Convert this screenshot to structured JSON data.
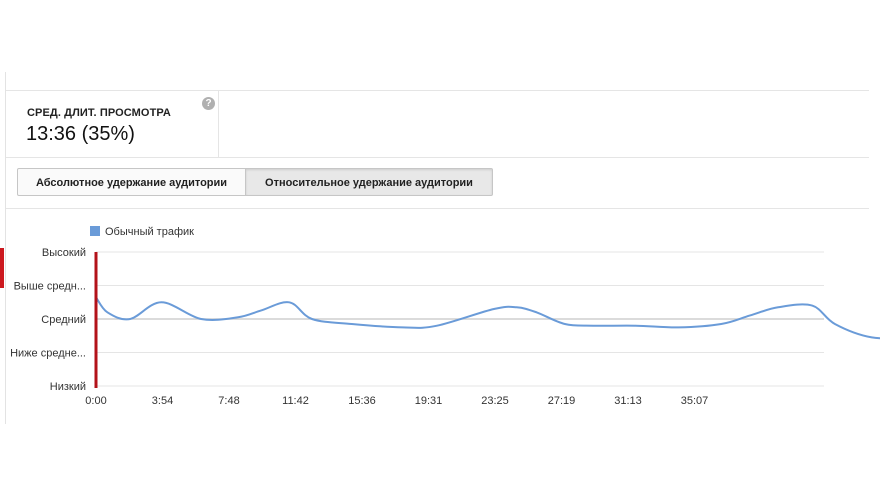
{
  "metric": {
    "label": "СРЕД. ДЛИТ. ПРОСМОТРА",
    "value": "13:36 (35%)",
    "help_glyph": "?"
  },
  "tabs": [
    {
      "label": "Абсолютное удержание аудитории",
      "selected": false
    },
    {
      "label": "Относительное удержание аудитории",
      "selected": true
    }
  ],
  "colors": {
    "series": "#6a9bd8",
    "marker": "#b3121a",
    "accent_red": "#cc181e",
    "grid": "#e5e5e5",
    "average_line": "#cfcfcf"
  },
  "chart_data": {
    "type": "line",
    "legend": {
      "position": "top-left",
      "entries": [
        "Обычный трафик"
      ]
    },
    "x_ticks": [
      "0:00",
      "3:54",
      "7:48",
      "11:42",
      "15:36",
      "19:31",
      "23:25",
      "27:19",
      "31:13",
      "35:07"
    ],
    "x_range_seconds": [
      0,
      2340
    ],
    "y_categories": [
      "Низкий",
      "Ниже средне...",
      "Средний",
      "Выше средн...",
      "Высокий"
    ],
    "y_range": [
      0,
      4
    ],
    "grid": true,
    "playhead_seconds": 0,
    "series": [
      {
        "name": "Обычный трафик",
        "x_seconds": [
          0,
          40,
          120,
          230,
          370,
          500,
          580,
          680,
          760,
          900,
          1080,
          1200,
          1400,
          1480,
          1550,
          1650,
          1750,
          1900,
          2050,
          2200,
          2300,
          2400,
          2520,
          2600,
          2730,
          2870
        ],
        "values": [
          2.65,
          2.2,
          2.0,
          2.5,
          2.0,
          2.05,
          2.25,
          2.5,
          2.0,
          1.85,
          1.75,
          1.8,
          2.3,
          2.35,
          2.2,
          1.85,
          1.8,
          1.8,
          1.75,
          1.85,
          2.1,
          2.35,
          2.4,
          1.85,
          1.45,
          1.45
        ]
      }
    ]
  }
}
